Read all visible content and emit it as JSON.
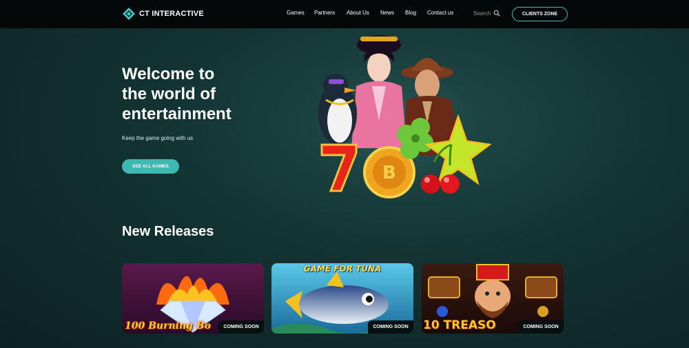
{
  "header": {
    "logo_text": "CT INTERACTIVE",
    "nav": [
      {
        "label": "Games"
      },
      {
        "label": "Partners"
      },
      {
        "label": "About Us"
      },
      {
        "label": "News"
      },
      {
        "label": "Blog"
      },
      {
        "label": "Contact us"
      }
    ],
    "search_label": "Search",
    "search_icon": "search-icon",
    "clients_button": "CLIENTS ZONE"
  },
  "hero": {
    "title_lines": [
      "Welcome to",
      "the world of",
      "entertainment"
    ],
    "subtitle": "Keep the game going with us",
    "cta": "SEE ALL GAMES"
  },
  "releases": {
    "title": "New Releases",
    "cards": [
      {
        "title": "100 Burning Bo",
        "badge": "COMING SOON"
      },
      {
        "title": "GAME FOR TUNA",
        "badge": "COMING SOON"
      },
      {
        "title": "10 TREASO",
        "badge": "COMING SOON"
      }
    ]
  },
  "colors": {
    "accent": "#3fb8b2",
    "header_bg": "#040808",
    "page_bg": "#133232"
  }
}
